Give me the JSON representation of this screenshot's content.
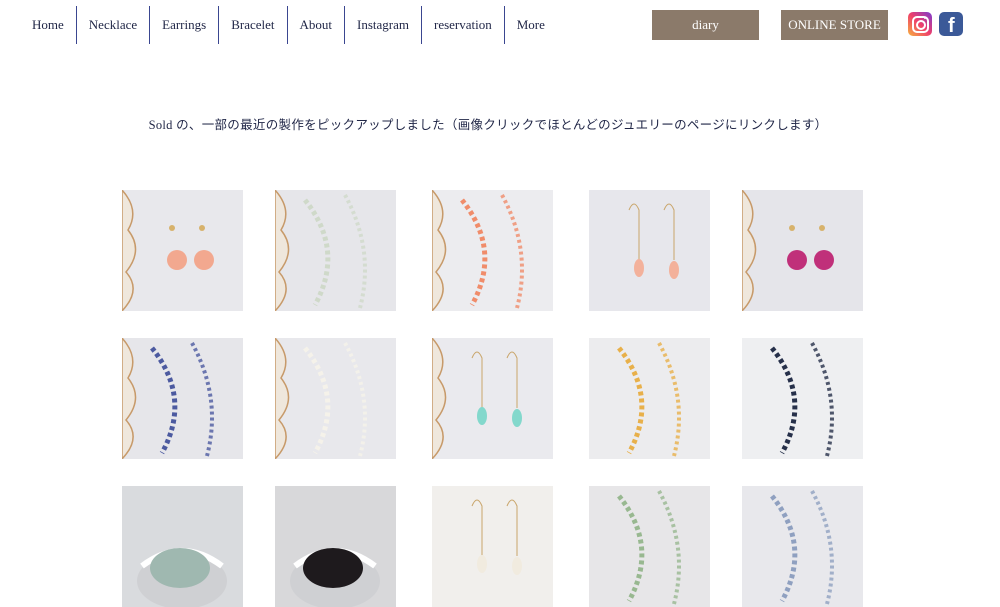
{
  "nav": {
    "items": [
      {
        "label": "Home"
      },
      {
        "label": "Necklace"
      },
      {
        "label": "Earrings"
      },
      {
        "label": "Bracelet"
      },
      {
        "label": "About"
      },
      {
        "label": "Instagram"
      },
      {
        "label": "reservation"
      },
      {
        "label": "More"
      }
    ]
  },
  "header": {
    "diary_label": "diary",
    "store_label": "ONLINE STORE",
    "social": [
      "instagram-icon",
      "facebook-icon"
    ]
  },
  "caption": "Sold の、一部の最近の製作をピックアップしました（画像クリックでほとんどのジュエリーのページにリンクします）",
  "colors": {
    "text": "#1f2546",
    "nav_divider": "#3a4690",
    "button": "#8b7a6a",
    "facebook": "#3b5998"
  },
  "gallery": [
    {
      "item": "pink-stud-earrings"
    },
    {
      "item": "beaded-necklace"
    },
    {
      "item": "pink-stone-necklace"
    },
    {
      "item": "coral-drop-earrings"
    },
    {
      "item": "magenta-stud-earrings"
    },
    {
      "item": "blue-bead-bracelet"
    },
    {
      "item": "white-pendant-necklace"
    },
    {
      "item": "turquoise-drop-earrings"
    },
    {
      "item": "citrine-bracelet"
    },
    {
      "item": "dark-bead-necklace"
    },
    {
      "item": "aquamarine-ring"
    },
    {
      "item": "black-stone-ring"
    },
    {
      "item": "ivory-drop-earrings"
    },
    {
      "item": "mixed-bead-bracelet"
    },
    {
      "item": "gemstone-bracelet"
    }
  ]
}
